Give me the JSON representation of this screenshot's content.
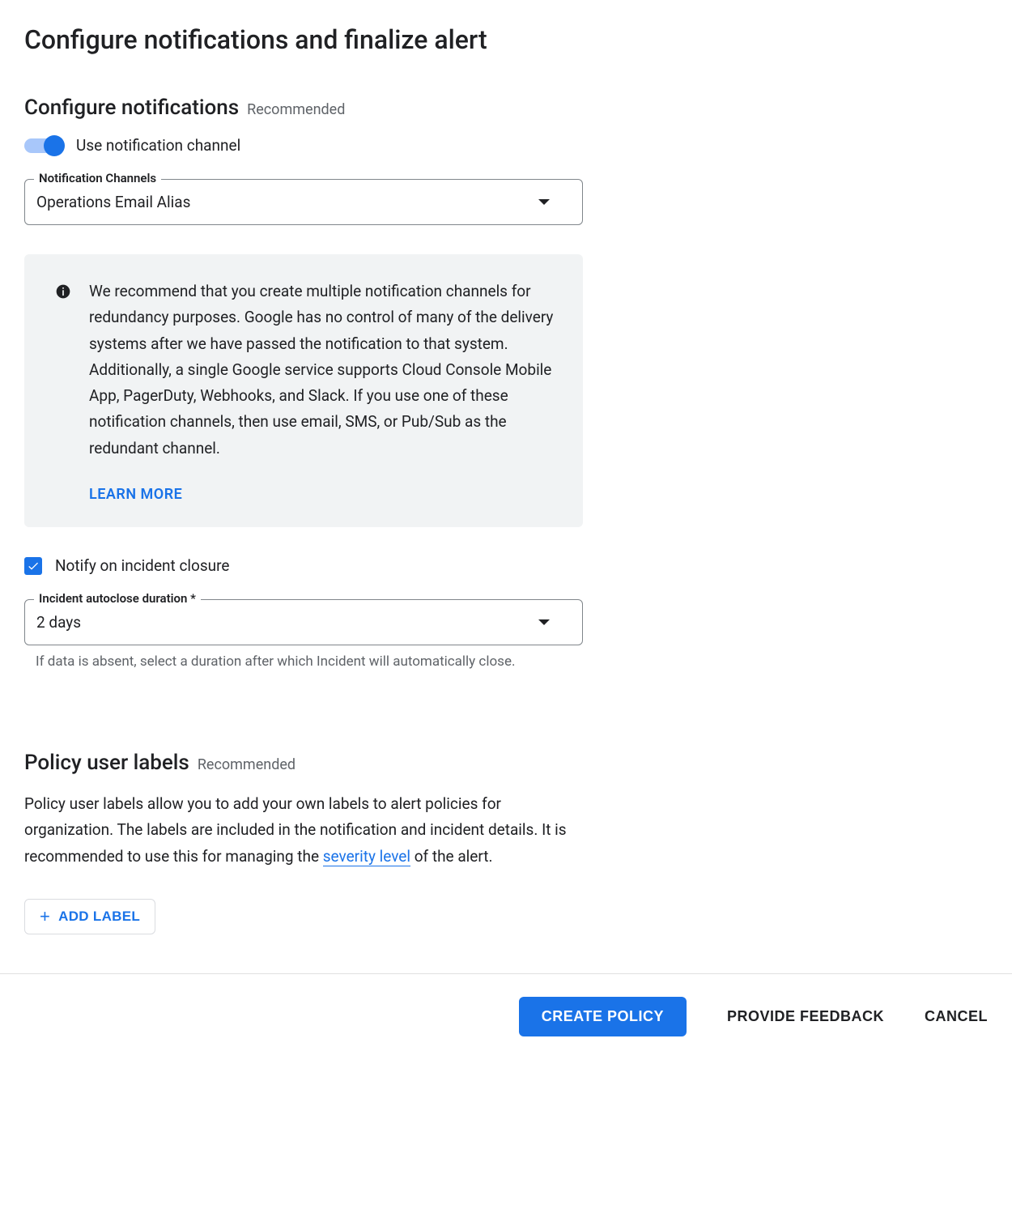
{
  "page": {
    "title": "Configure notifications and finalize alert"
  },
  "notifications": {
    "section_title": "Configure notifications",
    "recommended": "Recommended",
    "toggle_label": "Use notification channel",
    "toggle_on": true,
    "channels_field_label": "Notification Channels",
    "channels_value": "Operations Email Alias",
    "info_text": "We recommend that you create multiple notification channels for redundancy purposes. Google has no control of many of the delivery systems after we have passed the notification to that system. Additionally, a single Google service supports Cloud Console Mobile App, PagerDuty, Webhooks, and Slack. If you use one of these notification channels, then use email, SMS, or Pub/Sub as the redundant channel.",
    "learn_more": "LEARN MORE",
    "notify_closure_label": "Notify on incident closure",
    "notify_closure_checked": true,
    "autoclose_field_label": "Incident autoclose duration *",
    "autoclose_value": "2 days",
    "autoclose_helper": "If data is absent, select a duration after which Incident will automatically close."
  },
  "labels": {
    "section_title": "Policy user labels",
    "recommended": "Recommended",
    "desc_before_link": "Policy user labels allow you to add your own labels to alert policies for organization. The labels are included in the notification and incident details. It is recommended to use this for managing the ",
    "link_text": "severity level",
    "desc_after_link": " of the alert.",
    "add_label_btn": "ADD LABEL"
  },
  "footer": {
    "create_policy": "CREATE POLICY",
    "provide_feedback": "PROVIDE FEEDBACK",
    "cancel": "CANCEL"
  }
}
